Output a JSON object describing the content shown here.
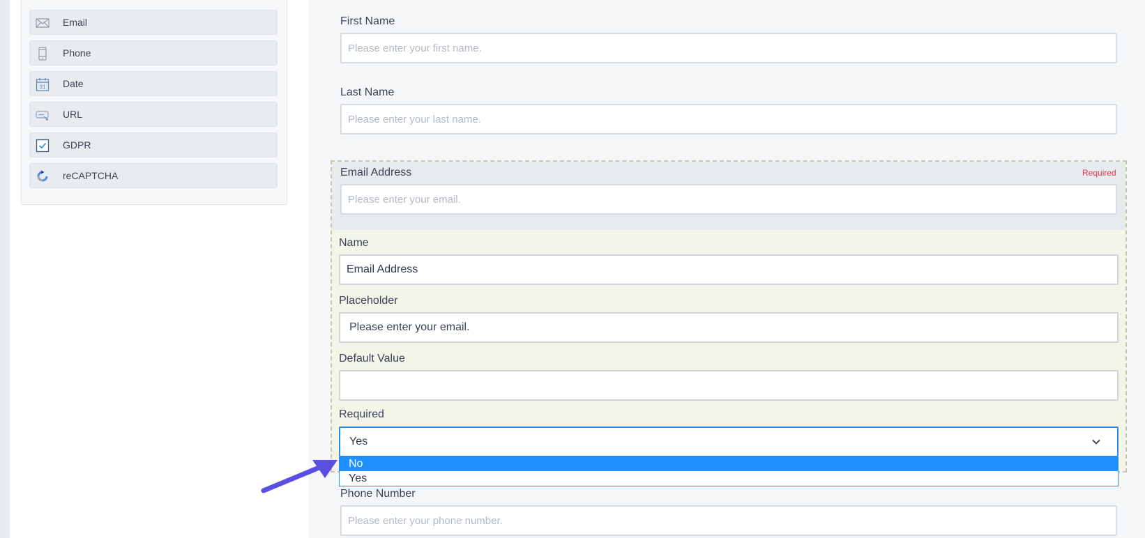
{
  "sidebar": {
    "items": [
      {
        "label": "Email",
        "icon": "envelope-icon"
      },
      {
        "label": "Phone",
        "icon": "phone-icon"
      },
      {
        "label": "Date",
        "icon": "calendar-icon"
      },
      {
        "label": "URL",
        "icon": "link-icon"
      },
      {
        "label": "GDPR",
        "icon": "checkbox-icon"
      },
      {
        "label": "reCAPTCHA",
        "icon": "recaptcha-icon"
      }
    ],
    "calendar_day": "31"
  },
  "form": {
    "first_name": {
      "label": "First Name",
      "placeholder": "Please enter your first name."
    },
    "last_name": {
      "label": "Last Name",
      "placeholder": "Please enter your last name."
    },
    "email": {
      "label": "Email Address",
      "placeholder": "Please enter your email.",
      "required_badge": "Required"
    },
    "phone": {
      "label": "Phone Number",
      "placeholder": "Please enter your phone number."
    }
  },
  "field_settings": {
    "name_label": "Name",
    "name_value": "Email Address",
    "placeholder_label": "Placeholder",
    "placeholder_value": "Please enter your email.",
    "default_label": "Default Value",
    "default_value": "",
    "required_label": "Required",
    "required_value": "Yes",
    "required_options": [
      "No",
      "Yes"
    ],
    "highlighted_option": "No"
  },
  "colors": {
    "accent_blue": "#1e90ff",
    "required_red": "#e0374f",
    "annotation_arrow": "#5b4fe0"
  }
}
